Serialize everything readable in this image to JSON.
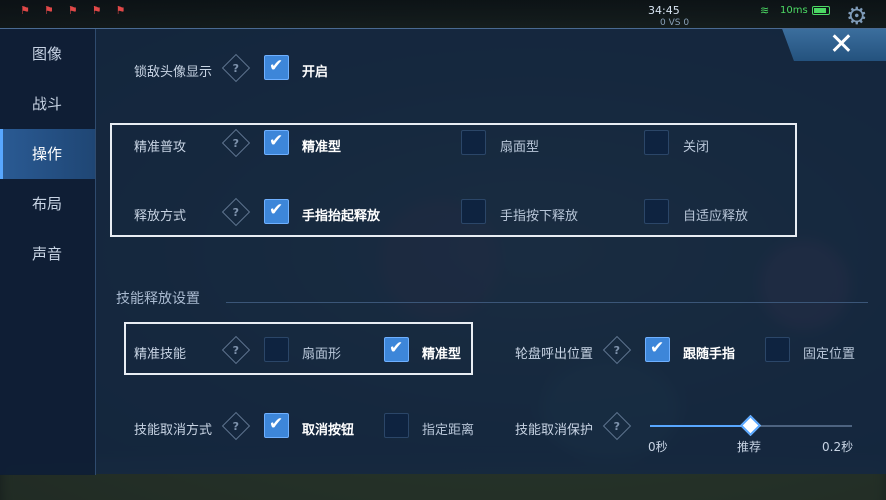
{
  "hud": {
    "time": "34:45",
    "score": "0 VS 0",
    "ping": "10ms"
  },
  "sidebar": {
    "items": [
      {
        "label": "图像"
      },
      {
        "label": "战斗"
      },
      {
        "label": "操作"
      },
      {
        "label": "布局"
      },
      {
        "label": "声音"
      }
    ],
    "active_index": 2
  },
  "settings": {
    "lock_avatar": {
      "label": "锁敌头像显示",
      "option": "开启",
      "checked": true
    },
    "precise_attack": {
      "label": "精准普攻",
      "options": [
        "精准型",
        "扇面型",
        "关闭"
      ],
      "selected": "精准型"
    },
    "release_mode": {
      "label": "释放方式",
      "options": [
        "手指抬起释放",
        "手指按下释放",
        "自适应释放"
      ],
      "selected": "手指抬起释放"
    },
    "skill_section_title": "技能释放设置",
    "precise_skill": {
      "label": "精准技能",
      "options": [
        "扇面形",
        "精准型"
      ],
      "selected": "精准型"
    },
    "wheel_position": {
      "label": "轮盘呼出位置",
      "options": [
        "跟随手指",
        "固定位置"
      ],
      "selected": "跟随手指"
    },
    "cancel_mode": {
      "label": "技能取消方式",
      "options": [
        "取消按钮",
        "指定距离"
      ],
      "selected": "取消按钮"
    },
    "cancel_protect": {
      "label": "技能取消保护",
      "min_label": "0秒",
      "rec_label": "推荐",
      "max_label": "0.2秒",
      "value_fraction": 0.5
    }
  },
  "help_glyph": "?",
  "close_glyph": "✕",
  "colors": {
    "accent": "#3d86d9",
    "panel": "#14283f",
    "frame": "#e8edf3"
  }
}
